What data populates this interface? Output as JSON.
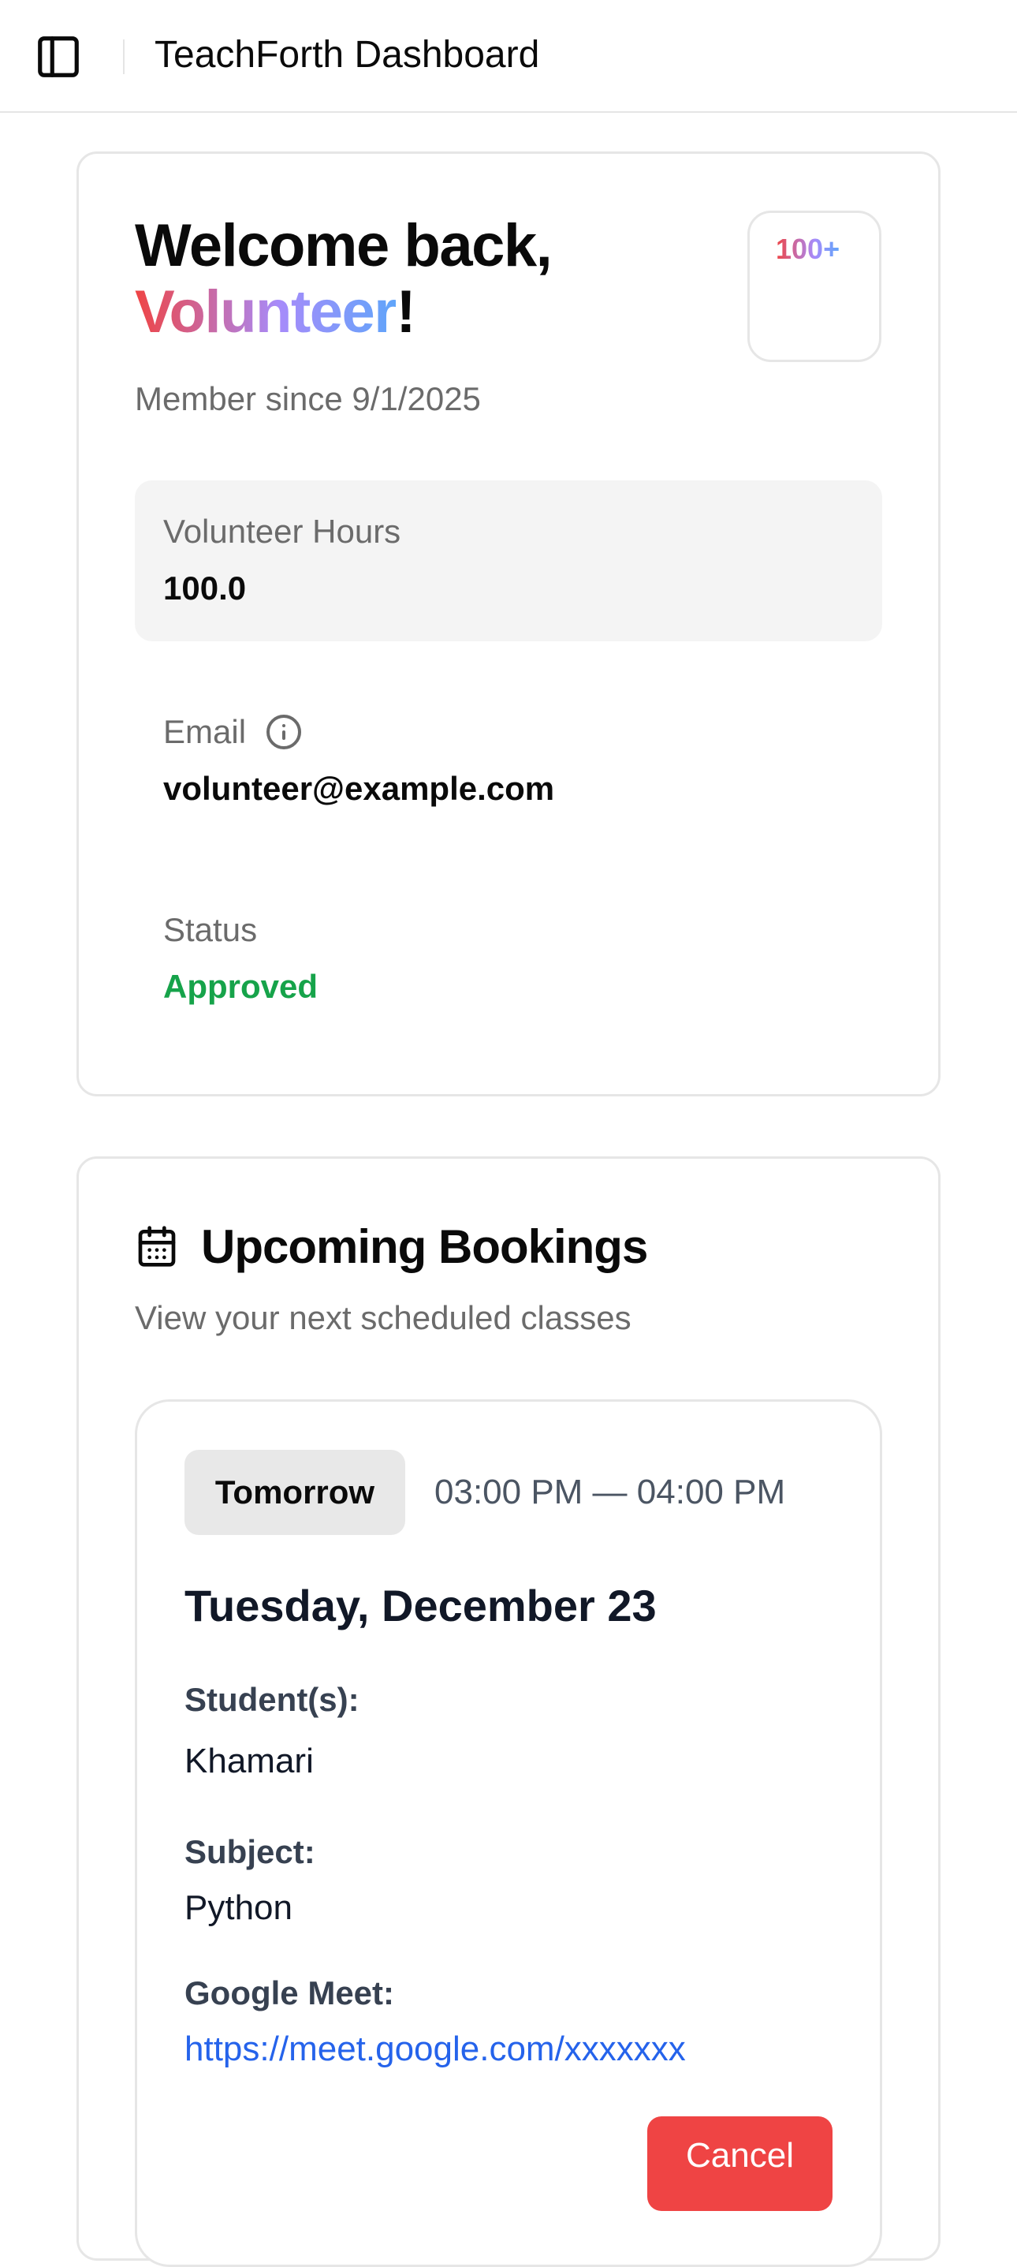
{
  "header": {
    "title": "TeachForth Dashboard",
    "toggle_icon": "sidebar-toggle-icon"
  },
  "profile": {
    "welcome_prefix": "Welcome back,",
    "name": "Volunteer",
    "exclamation": "!",
    "member_since": "Member since 9/1/2025",
    "badge": "100+",
    "hours_label": "Volunteer Hours",
    "hours_value": "100.0",
    "email_label": "Email",
    "email_value": "volunteer@example.com",
    "status_label": "Status",
    "status_value": "Approved"
  },
  "bookings": {
    "title": "Upcoming Bookings",
    "subtitle": "View your next scheduled classes",
    "items": [
      {
        "pill": "Tomorrow",
        "time": "03:00 PM — 04:00 PM",
        "date": "Tuesday, December 23",
        "students_label": "Student(s):",
        "students_value": "Khamari",
        "subject_label": "Subject:",
        "subject_value": "Python",
        "meet_label": "Google Meet:",
        "meet_link": "https://meet.google.com/xxxxxxx",
        "cancel_label": "Cancel"
      }
    ]
  },
  "colors": {
    "approved": "#16a34a",
    "link": "#2563eb",
    "cancel": "#ef4444",
    "gradient_start": "#ef4444",
    "gradient_end": "#60a5fa"
  }
}
